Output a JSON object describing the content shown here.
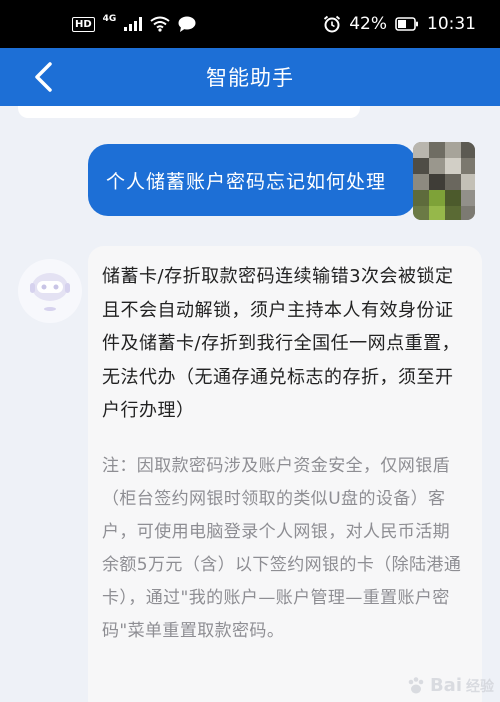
{
  "status_bar": {
    "hd": "HD",
    "network": "4G",
    "battery_percent": "42%",
    "time": "10:31"
  },
  "nav": {
    "title": "智能助手"
  },
  "chat": {
    "user_message": "个人储蓄账户密码忘记如何处理",
    "bot_reply": "储蓄卡/存折取款密码连续输错3次会被锁定且不会自动解锁，须户主持本人有效身份证件及储蓄卡/存折到我行全国任一网点重置，无法代办（无通存通兑标志的存折，须至开户行办理）",
    "bot_note": "注：因取款密码涉及账户资金安全，仅网银盾（柜台签约网银时领取的类似U盘的设备）客户，可使用电脑登录个人网银，对人民币活期余额5万元（含）以下签约网银的卡（除陆港通卡），通过\"我的账户—账户管理—重置账户密码\"菜单重置取款密码。"
  },
  "watermark": {
    "brand": "Bai",
    "suffix": "经验"
  },
  "colors": {
    "primary": "#1d6fd6",
    "background": "#eef1f7",
    "note_text": "#8e8e93"
  }
}
